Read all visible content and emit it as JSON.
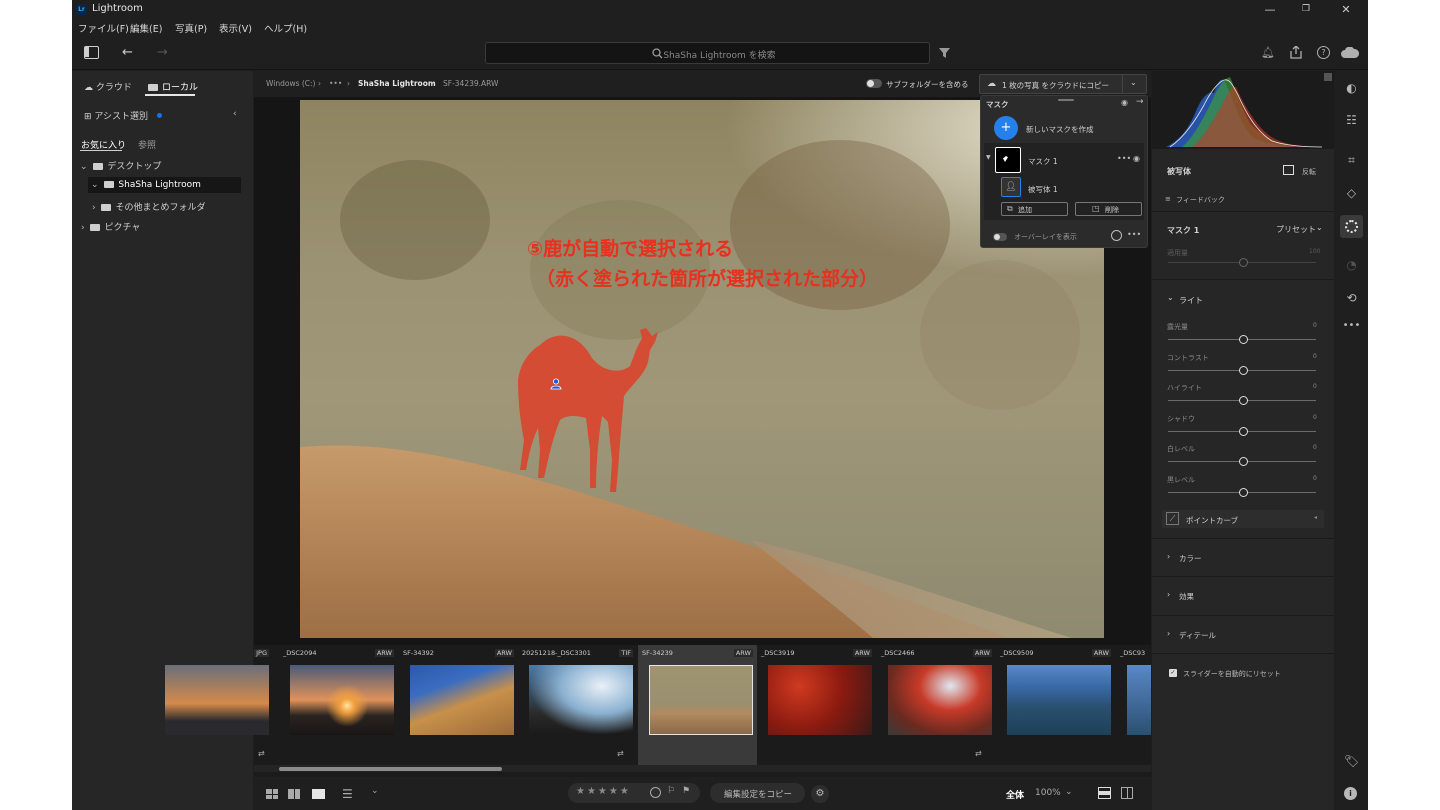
{
  "window": {
    "title": "Lightroom",
    "logo": "Lr",
    "minimize": "—",
    "restore": "❐",
    "close": "✕"
  },
  "menu": [
    "ファイル(F)",
    "編集(E)",
    "写真(P)",
    "表示(V)",
    "ヘルプ(H)"
  ],
  "toolbar": {
    "search_placeholder": "ShaSha Lightroom を検索"
  },
  "left": {
    "tab_cloud": "クラウド",
    "tab_local": "ローカル",
    "assist": "アシスト選別",
    "sub_favorites": "お気に入り",
    "sub_browse": "参照",
    "folders": [
      "デスクトップ",
      "ShaSha Lightroom",
      "その他まとめフォルダ",
      "ピクチャ"
    ]
  },
  "breadcrumb": {
    "drive": "Windows (C:)",
    "ellipsis": "•••",
    "folder": "ShaSha Lightroom",
    "file": "SF-34239.ARW",
    "include_subfolders": "サブフォルダーを含める",
    "copy_to_cloud": "1 枚の写真 をクラウドにコピー"
  },
  "annotation": {
    "line1": "⑤鹿が自動で選択される",
    "line2": "（赤く塗られた箇所が選択された部分）"
  },
  "mask_panel": {
    "title": "マスク",
    "new_mask": "新しいマスクを作成",
    "mask_name": "マスク 1",
    "subject": "被写体 1",
    "add": "追加",
    "delete": "削除",
    "overlay": "オーバーレイを表示"
  },
  "filmstrip": [
    {
      "name": "",
      "ext": "JPG"
    },
    {
      "name": "_DSC2094",
      "ext": "ARW"
    },
    {
      "name": "SF-34392",
      "ext": "ARW"
    },
    {
      "name": "20251218-_DSC3301",
      "ext": "TIF"
    },
    {
      "name": "SF-34239",
      "ext": "ARW"
    },
    {
      "name": "_DSC3919",
      "ext": "ARW"
    },
    {
      "name": "_DSC2466",
      "ext": "ARW"
    },
    {
      "name": "_DSC9509",
      "ext": "ARW"
    },
    {
      "name": "_DSC93",
      "ext": ""
    }
  ],
  "bottom": {
    "stars": "★★★★★",
    "copy_settings": "編集設定をコピー",
    "fit": "全体",
    "zoom": "100%"
  },
  "right": {
    "subject_header": "被写体",
    "invert": "反転",
    "feedback": "フィードバック",
    "mask_label": "マスク 1",
    "preset": "プリセット",
    "amount": "適用量",
    "amount_value": "100",
    "light": "ライト",
    "sliders": [
      {
        "label": "露光量",
        "value": "0"
      },
      {
        "label": "コントラスト",
        "value": "0"
      },
      {
        "label": "ハイライト",
        "value": "0"
      },
      {
        "label": "シャドウ",
        "value": "0"
      },
      {
        "label": "白レベル",
        "value": "0"
      },
      {
        "label": "黒レベル",
        "value": "0"
      }
    ],
    "point_curve": "ポイントカーブ",
    "color": "カラー",
    "effects": "効果",
    "detail": "ディテール",
    "auto_reset": "スライダーを自動的にリセット"
  },
  "colors": {
    "accent": "#1473e6",
    "mask_red": "#e8301f",
    "panel": "#262626"
  }
}
